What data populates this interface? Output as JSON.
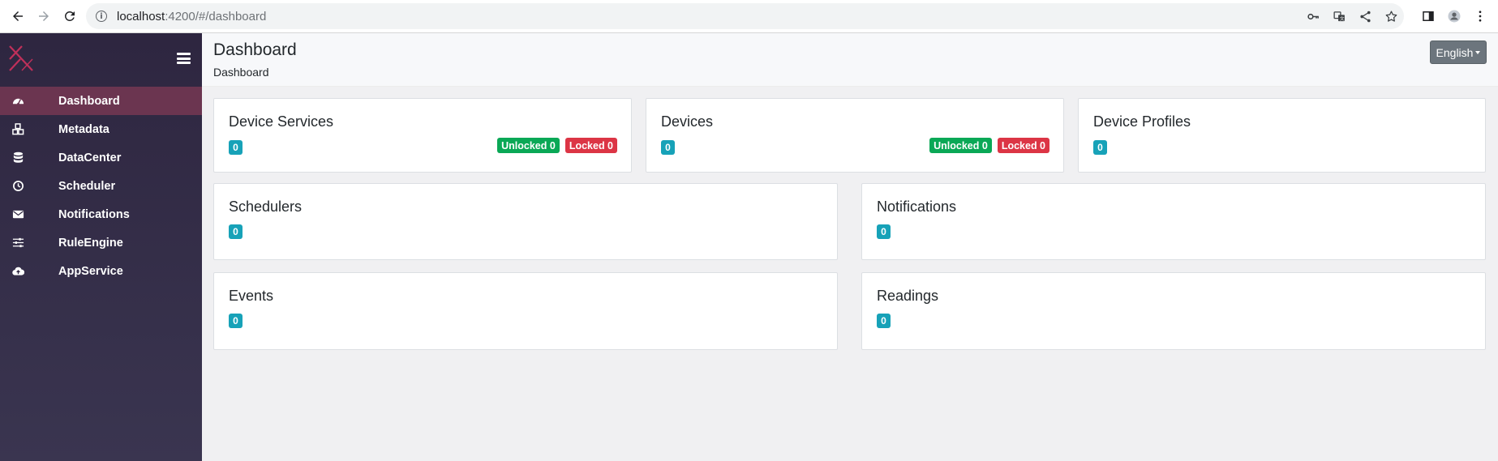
{
  "browser": {
    "url_host": "localhost",
    "url_path": ":4200/#/dashboard"
  },
  "sidebar": {
    "items": [
      {
        "label": "Dashboard",
        "icon": "tachometer-icon",
        "active": true
      },
      {
        "label": "Metadata",
        "icon": "cubes-icon",
        "active": false
      },
      {
        "label": "DataCenter",
        "icon": "database-icon",
        "active": false
      },
      {
        "label": "Scheduler",
        "icon": "clock-icon",
        "active": false
      },
      {
        "label": "Notifications",
        "icon": "envelope-icon",
        "active": false
      },
      {
        "label": "RuleEngine",
        "icon": "sliders-icon",
        "active": false
      },
      {
        "label": "AppService",
        "icon": "cloud-upload-icon",
        "active": false
      }
    ]
  },
  "header": {
    "title": "Dashboard",
    "breadcrumb": "Dashboard",
    "language": "English"
  },
  "cards": {
    "device_services": {
      "title": "Device Services",
      "count": "0",
      "unlocked": "Unlocked 0",
      "locked": "Locked 0"
    },
    "devices": {
      "title": "Devices",
      "count": "0",
      "unlocked": "Unlocked 0",
      "locked": "Locked 0"
    },
    "device_profiles": {
      "title": "Device Profiles",
      "count": "0"
    },
    "schedulers": {
      "title": "Schedulers",
      "count": "0"
    },
    "notifications": {
      "title": "Notifications",
      "count": "0"
    },
    "events": {
      "title": "Events",
      "count": "0"
    },
    "readings": {
      "title": "Readings",
      "count": "0"
    }
  },
  "colors": {
    "sidebar_bg": "#2e2640",
    "sidebar_active": "#6b3550",
    "count_badge": "#17a2b8",
    "unlocked_badge": "#0aa856",
    "locked_badge": "#dc3545",
    "lang_button": "#6c757d"
  }
}
